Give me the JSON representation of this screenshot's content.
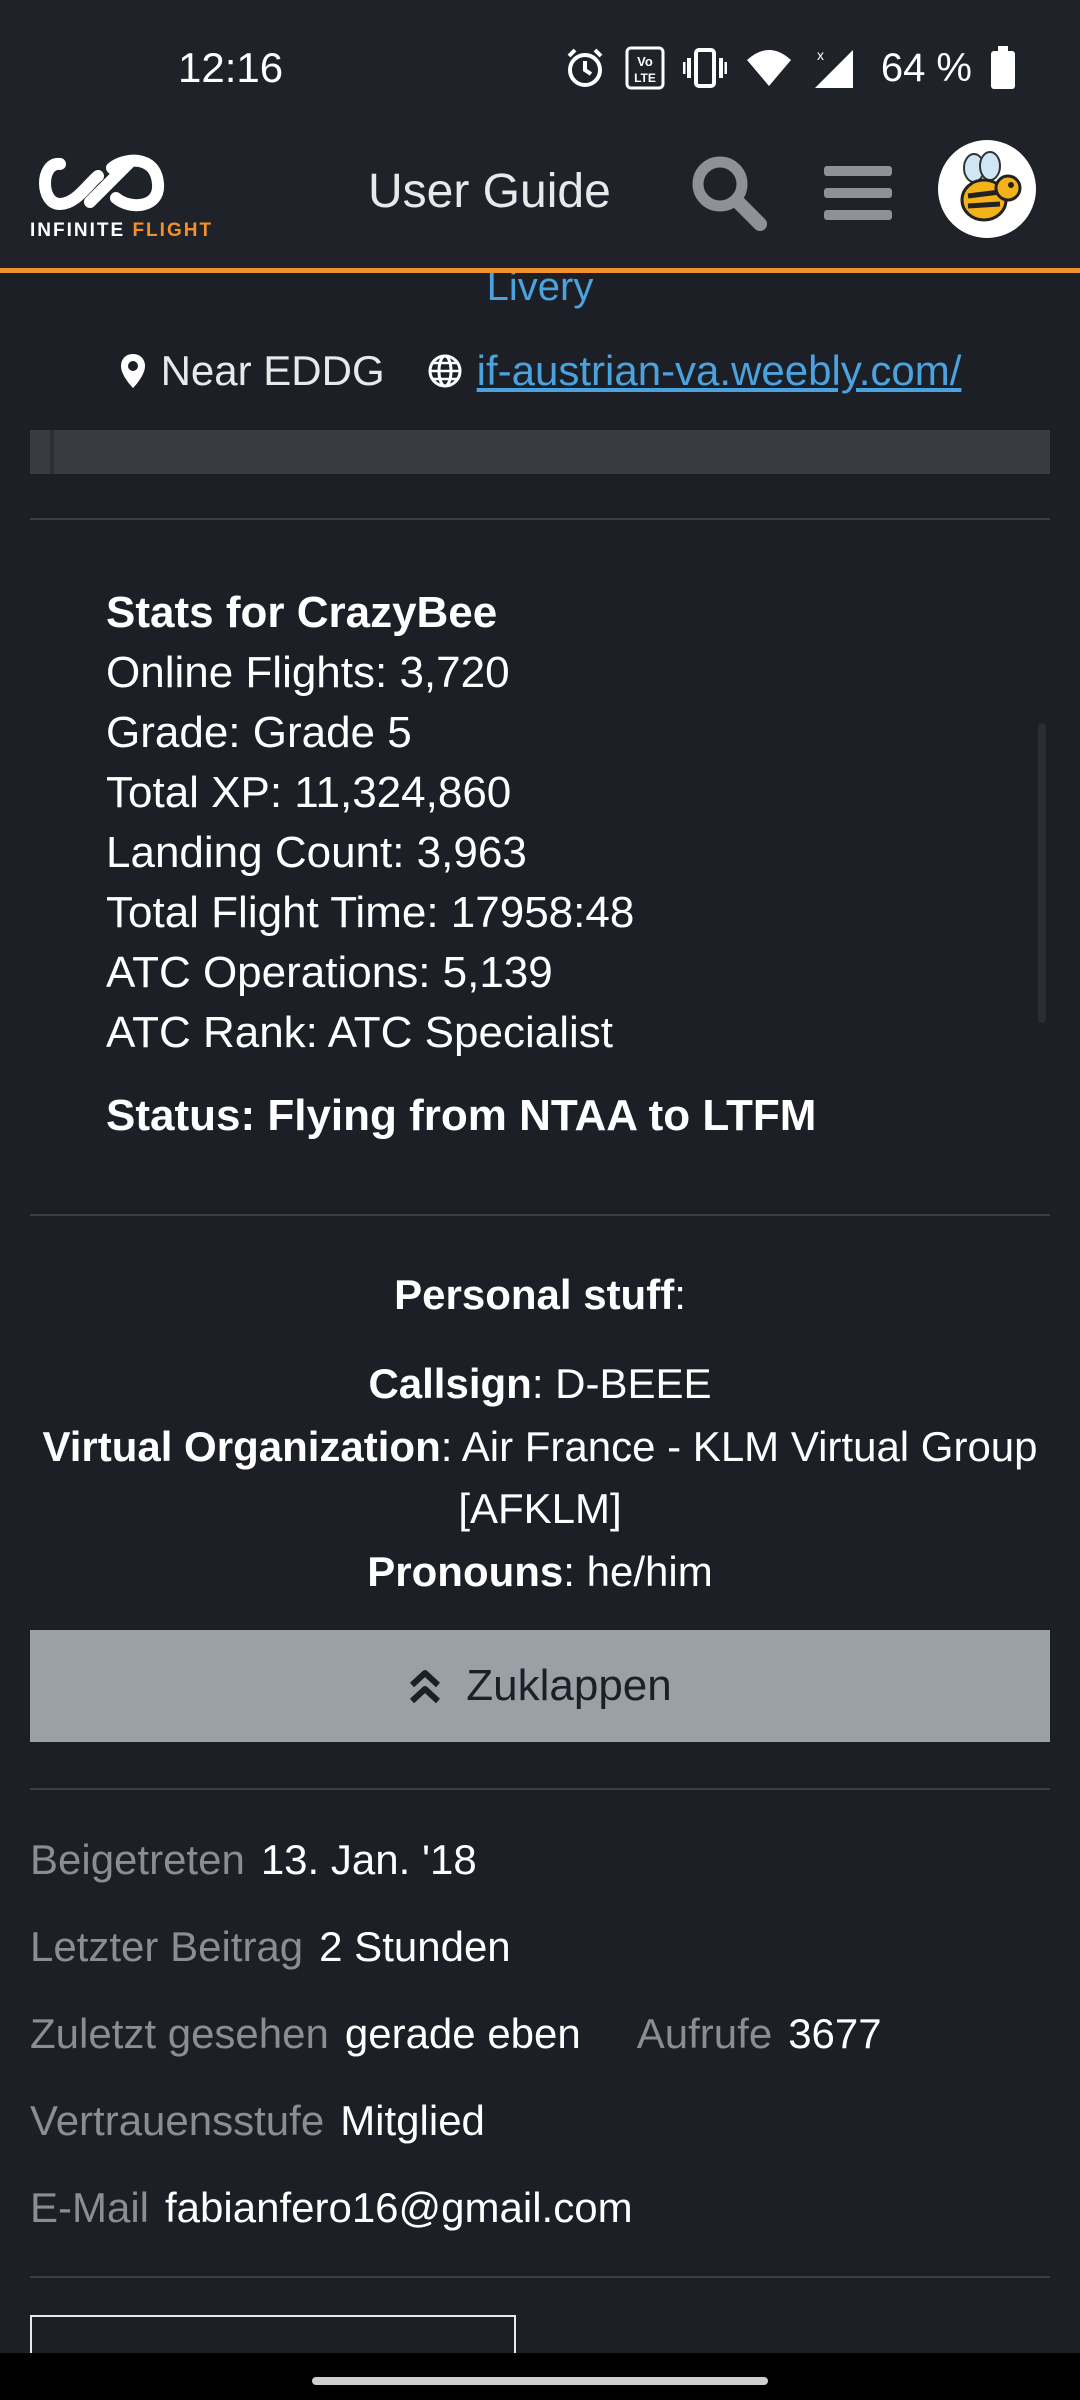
{
  "status_bar": {
    "time": "12:16",
    "battery_pct": "64 %",
    "icons": [
      "alarm-icon",
      "volte-icon",
      "vibrate-icon",
      "wifi-icon",
      "signal-icon",
      "battery-icon"
    ]
  },
  "header": {
    "logo_word1": "INFINITE",
    "logo_word2": "FLIGHT",
    "title": "User Guide",
    "icons": [
      "search-icon",
      "menu-icon",
      "avatar-bee"
    ],
    "accent_color": "#f0912c"
  },
  "profile_top": {
    "livery": "Livery",
    "location": "Near EDDG",
    "website": "if-austrian-va.weebly.com/"
  },
  "stats": {
    "title": "Stats for CrazyBee",
    "online_flights": "Online Flights: 3,720",
    "grade": "Grade: Grade 5",
    "total_xp": "Total XP: 11,324,860",
    "landing_count": "Landing Count: 3,963",
    "total_flight_time": "Total Flight Time: 17958:48",
    "atc_operations": "ATC Operations: 5,139",
    "atc_rank": "ATC Rank: ATC Specialist",
    "status": "Status: Flying from NTAA to LTFM"
  },
  "personal": {
    "heading": "Personal stuff",
    "heading_suffix": ":",
    "callsign_label": "Callsign",
    "callsign_value": ": D-BEEE",
    "vo_label": "Virtual Organization",
    "vo_value_line1": ": Air France - KLM Virtual Group",
    "vo_value_line2": "[AFKLM]",
    "pronouns_label": "Pronouns",
    "pronouns_value": ": he/him"
  },
  "collapse_button": {
    "label": "Zuklappen",
    "icon": "double-chevron-up-icon"
  },
  "meta": {
    "joined_label": "Beigetreten",
    "joined_value": "13. Jan. '18",
    "last_post_label": "Letzter Beitrag",
    "last_post_value": "2 Stunden",
    "last_seen_label": "Zuletzt gesehen",
    "last_seen_value": "gerade eben",
    "views_label": "Aufrufe",
    "views_value": "3677",
    "trust_label": "Vertrauensstufe",
    "trust_value": "Mitglied",
    "email_label": "E-Mail",
    "email_value": "fabianfero16@gmail.com"
  }
}
